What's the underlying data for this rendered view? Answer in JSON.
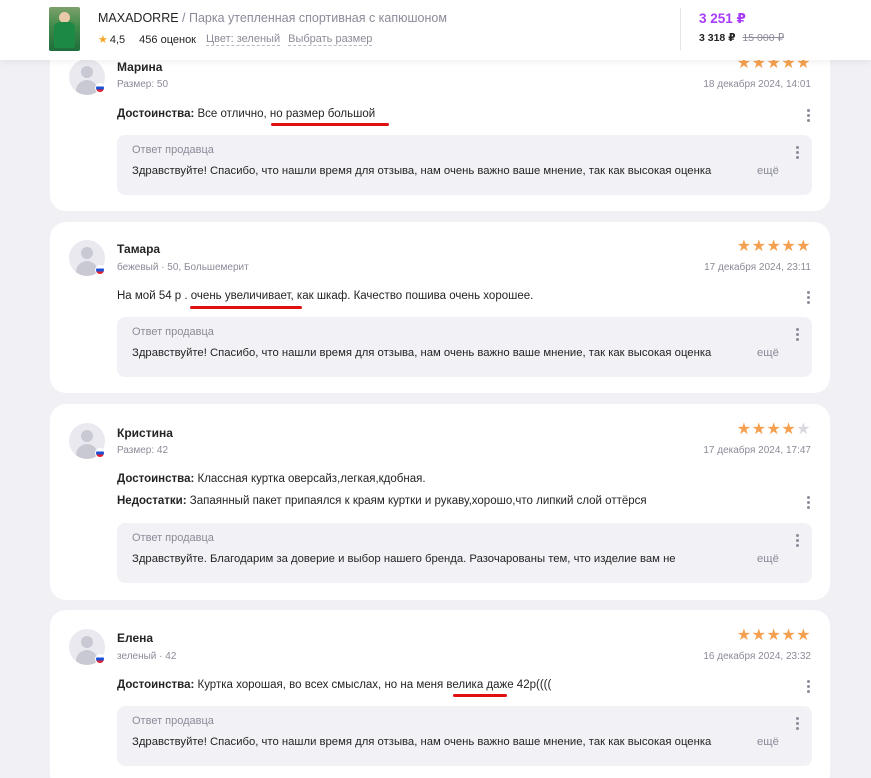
{
  "header": {
    "brand": "MAXADORRE",
    "separator": " / ",
    "product_name": "Парка утепленная спортивная с капюшоном",
    "rating": "4,5",
    "reviews_count": "456 оценок",
    "color_link": "Цвет: зеленый",
    "size_link": "Выбрать размер",
    "price": "3 251 ₽",
    "wallet_price": "3 318 ₽",
    "old_price": "15 000 ₽",
    "colors": {
      "price": "#a73afd",
      "star": "#f5a623"
    }
  },
  "answer_labels": {
    "title": "Ответ продавца",
    "more": "ещё"
  },
  "reviews": [
    {
      "author": "Марина",
      "sub": "Размер: 50",
      "stars": 5,
      "date": "18 декабря 2024, 14:01",
      "pros_label": "Достоинства:",
      "pros": " Все отлично, но размер большой",
      "answer": "Здравствуйте! Спасибо, что нашли время для отзыва, нам очень важно ваше мнение, так как высокая оценка"
    },
    {
      "author": "Тамара",
      "sub": "бежевый · 50, Большемерит",
      "stars": 5,
      "date": "17 декабря 2024, 23:11",
      "text": "На мой 54 р . очень увеличивает, как шкаф. Качество пошива очень хорошее.",
      "answer": "Здравствуйте! Спасибо, что нашли время для отзыва, нам очень важно ваше мнение, так как высокая оценка"
    },
    {
      "author": "Кристина",
      "sub": "Размер: 42",
      "stars": 4,
      "date": "17 декабря 2024, 17:47",
      "pros_label": "Достоинства:",
      "pros": " Классная куртка оверсайз,легкая,кдобная.",
      "cons_label": "Недостатки:",
      "cons": " Запаянный пакет припаялся к краям куртки и рукаву,хорошо,что липкий слой оттёрся",
      "answer": "Здравствуйте. Благодарим за доверие и выбор нашего бренда. Разочарованы тем, что изделие вам не"
    },
    {
      "author": "Елена",
      "sub": "зеленый · 42",
      "stars": 5,
      "date": "16 декабря 2024, 23:32",
      "pros_label": "Достоинства:",
      "pros": " Куртка хорошая, во всех смыслах, но на меня велика даже 42р((((",
      "answer": "Здравствуйте! Спасибо, что нашли время для отзыва, нам очень важно ваше мнение, так как высокая оценка"
    }
  ]
}
